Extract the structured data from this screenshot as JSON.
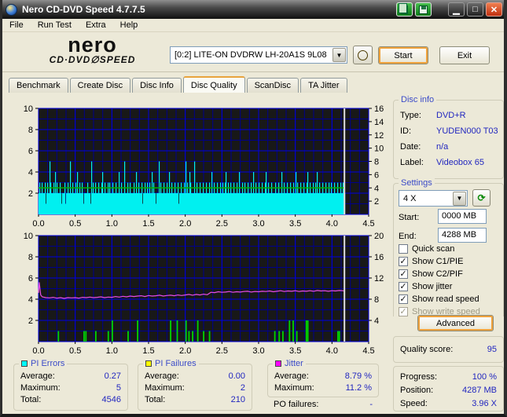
{
  "titlebar": {
    "title": "Nero CD-DVD Speed 4.7.7.5"
  },
  "menu": [
    "File",
    "Run Test",
    "Extra",
    "Help"
  ],
  "logo": {
    "line1": "nero",
    "line2": "CD·DVD∅SPEED"
  },
  "header": {
    "drive": "[0:2]   LITE-ON DVDRW LH-20A1S 9L08",
    "start_label": "Start",
    "exit_label": "Exit"
  },
  "tabs": [
    {
      "label": "Benchmark",
      "active": false
    },
    {
      "label": "Create Disc",
      "active": false
    },
    {
      "label": "Disc Info",
      "active": false
    },
    {
      "label": "Disc Quality",
      "active": true
    },
    {
      "label": "ScanDisc",
      "active": false
    },
    {
      "label": "TA Jitter",
      "active": false
    }
  ],
  "disc_info": {
    "title": "Disc info",
    "rows": [
      {
        "label": "Type:",
        "value": "DVD+R"
      },
      {
        "label": "ID:",
        "value": "YUDEN000 T03"
      },
      {
        "label": "Date:",
        "value": "n/a"
      },
      {
        "label": "Label:",
        "value": "Videobox 65"
      }
    ]
  },
  "settings": {
    "title": "Settings",
    "speed": "4 X",
    "start_label": "Start:",
    "start_value": "0000 MB",
    "end_label": "End:",
    "end_value": "4288 MB",
    "checkboxes": [
      {
        "label": "Quick scan",
        "checked": false,
        "enabled": true
      },
      {
        "label": "Show C1/PIE",
        "checked": true,
        "enabled": true
      },
      {
        "label": "Show C2/PIF",
        "checked": true,
        "enabled": true
      },
      {
        "label": "Show jitter",
        "checked": true,
        "enabled": true
      },
      {
        "label": "Show read speed",
        "checked": true,
        "enabled": true
      },
      {
        "label": "Show write speed",
        "checked": true,
        "enabled": false
      }
    ],
    "advanced_label": "Advanced"
  },
  "quality": {
    "label": "Quality score:",
    "value": "95"
  },
  "progress": {
    "rows": [
      {
        "label": "Progress:",
        "value": "100 %"
      },
      {
        "label": "Position:",
        "value": "4287 MB"
      },
      {
        "label": "Speed:",
        "value": "3.96 X"
      }
    ]
  },
  "stat_boxes": [
    {
      "title": "PI Errors",
      "color": "#00ffff",
      "rows": [
        {
          "label": "Average:",
          "value": "0.27"
        },
        {
          "label": "Maximum:",
          "value": "5"
        },
        {
          "label": "Total:",
          "value": "4546"
        }
      ]
    },
    {
      "title": "PI Failures",
      "color": "#ffff00",
      "rows": [
        {
          "label": "Average:",
          "value": "0.00"
        },
        {
          "label": "Maximum:",
          "value": "2"
        },
        {
          "label": "Total:",
          "value": "210"
        }
      ]
    },
    {
      "title": "Jitter",
      "color": "#ff00ff",
      "rows": [
        {
          "label": "Average:",
          "value": "8.79 %"
        },
        {
          "label": "Maximum:",
          "value": "11.2 %"
        }
      ]
    }
  ],
  "po_failures": {
    "label": "PO failures:",
    "value": "-"
  },
  "chart_data": [
    {
      "type": "bar",
      "name": "pi-errors-and-read-speed",
      "x_range": [
        0,
        4.5
      ],
      "x_major": 0.5,
      "x_minor": 0.125,
      "x_ticks": [
        "0.0",
        "0.5",
        "1.0",
        "1.5",
        "2.0",
        "2.5",
        "3.0",
        "3.5",
        "4.0",
        "4.5"
      ],
      "left_range": [
        0,
        10
      ],
      "left_major": 2,
      "left_minor": 1,
      "left_ticks": [
        2,
        4,
        6,
        8,
        10
      ],
      "right_range": [
        0,
        16
      ],
      "right_ticks": [
        2,
        4,
        6,
        8,
        10,
        12,
        14,
        16
      ],
      "bars_color": "#00f0f0",
      "bars_axis": "left",
      "bars_digits": "232232223123225322232423222321222312232252232223242232232122223222152322322232223422322232322232223222422322252223223222232242232223122322322322423221222523222322232242232223222312232223252322432222522322232223222322232242232223222322322342232232223222322422232232223222322422322232223222342232223222232223222422322232223222322423222322232223422322232232422322232223222322322232223222322322",
      "speed_line": {
        "value": 4.0,
        "axis": "right",
        "x_start": 0,
        "x_end": 4.17,
        "color": "#00b000"
      },
      "cursor_x": 4.17,
      "cursor_color": "#e0e0e0",
      "bg": "#181818",
      "grid_minor": "#00008c",
      "grid_major": "#0000e0"
    },
    {
      "type": "bar+line",
      "name": "pi-failures-and-jitter",
      "x_range": [
        0,
        4.5
      ],
      "x_major": 0.5,
      "x_minor": 0.125,
      "x_ticks": [
        "0.0",
        "0.5",
        "1.0",
        "1.5",
        "2.0",
        "2.5",
        "3.0",
        "3.5",
        "4.0",
        "4.5"
      ],
      "left_range": [
        0,
        10
      ],
      "left_major": 2,
      "left_minor": 1,
      "left_ticks": [
        2,
        4,
        6,
        8,
        10
      ],
      "right_range": [
        0,
        20
      ],
      "right_ticks": [
        4,
        8,
        12,
        16,
        20
      ],
      "pif_bars_color": "#00d400",
      "pif_bars": [
        [
          0.27,
          1
        ],
        [
          0.62,
          1
        ],
        [
          0.645,
          1
        ],
        [
          0.78,
          1
        ],
        [
          0.95,
          1
        ],
        [
          1.005,
          2
        ],
        [
          1.22,
          1
        ],
        [
          1.35,
          2
        ],
        [
          1.8,
          2
        ],
        [
          1.89,
          2
        ],
        [
          2.01,
          2
        ],
        [
          2.05,
          1
        ],
        [
          2.1,
          1
        ],
        [
          2.17,
          2
        ],
        [
          2.25,
          1
        ],
        [
          2.33,
          1
        ],
        [
          3.22,
          1
        ],
        [
          3.28,
          1
        ],
        [
          3.33,
          1
        ],
        [
          3.42,
          2
        ],
        [
          3.47,
          2
        ],
        [
          3.52,
          1
        ],
        [
          3.65,
          2
        ],
        [
          3.67,
          2
        ],
        [
          4.08,
          1
        ],
        [
          4.1,
          1
        ]
      ],
      "jitter_color": "#e84ce8",
      "jitter_axis": "right",
      "jitter_points": [
        [
          0.0,
          9.2
        ],
        [
          0.01,
          11.2
        ],
        [
          0.03,
          8.8
        ],
        [
          0.05,
          8.45
        ],
        [
          0.1,
          8.3
        ],
        [
          0.15,
          8.25
        ],
        [
          0.2,
          8.35
        ],
        [
          0.25,
          8.2
        ],
        [
          0.3,
          8.3
        ],
        [
          0.35,
          8.15
        ],
        [
          0.4,
          8.3
        ],
        [
          0.45,
          8.25
        ],
        [
          0.5,
          8.3
        ],
        [
          0.55,
          8.2
        ],
        [
          0.6,
          8.35
        ],
        [
          0.65,
          8.3
        ],
        [
          0.7,
          8.4
        ],
        [
          0.75,
          8.3
        ],
        [
          0.8,
          8.35
        ],
        [
          0.85,
          8.45
        ],
        [
          0.9,
          8.3
        ],
        [
          0.95,
          8.4
        ],
        [
          1.0,
          8.35
        ],
        [
          1.05,
          8.5
        ],
        [
          1.1,
          8.4
        ],
        [
          1.15,
          8.55
        ],
        [
          1.2,
          8.45
        ],
        [
          1.25,
          8.6
        ],
        [
          1.3,
          8.5
        ],
        [
          1.35,
          8.6
        ],
        [
          1.4,
          8.65
        ],
        [
          1.45,
          8.5
        ],
        [
          1.5,
          8.7
        ],
        [
          1.55,
          8.6
        ],
        [
          1.6,
          8.65
        ],
        [
          1.65,
          8.75
        ],
        [
          1.7,
          8.6
        ],
        [
          1.75,
          8.7
        ],
        [
          1.8,
          8.75
        ],
        [
          1.85,
          8.65
        ],
        [
          1.9,
          8.8
        ],
        [
          1.95,
          8.7
        ],
        [
          2.0,
          8.8
        ],
        [
          2.05,
          8.9
        ],
        [
          2.1,
          8.75
        ],
        [
          2.15,
          8.9
        ],
        [
          2.2,
          8.8
        ],
        [
          2.25,
          8.95
        ],
        [
          2.3,
          8.85
        ],
        [
          2.35,
          9.3
        ],
        [
          2.4,
          9.25
        ],
        [
          2.45,
          9.4
        ],
        [
          2.5,
          9.3
        ],
        [
          2.55,
          9.35
        ],
        [
          2.6,
          9.45
        ],
        [
          2.65,
          9.3
        ],
        [
          2.7,
          9.4
        ],
        [
          2.75,
          9.35
        ],
        [
          2.8,
          9.45
        ],
        [
          2.85,
          9.5
        ],
        [
          2.9,
          9.35
        ],
        [
          2.95,
          9.45
        ],
        [
          3.0,
          9.4
        ],
        [
          3.05,
          9.5
        ],
        [
          3.1,
          9.45
        ],
        [
          3.15,
          9.55
        ],
        [
          3.2,
          9.4
        ],
        [
          3.25,
          9.5
        ],
        [
          3.3,
          9.6
        ],
        [
          3.35,
          9.45
        ],
        [
          3.4,
          9.55
        ],
        [
          3.45,
          9.5
        ],
        [
          3.5,
          9.6
        ],
        [
          3.55,
          9.45
        ],
        [
          3.6,
          9.55
        ],
        [
          3.65,
          9.5
        ],
        [
          3.7,
          9.6
        ],
        [
          3.75,
          9.5
        ],
        [
          3.8,
          9.65
        ],
        [
          3.85,
          9.55
        ],
        [
          3.9,
          9.6
        ],
        [
          3.95,
          9.5
        ],
        [
          4.0,
          9.6
        ],
        [
          4.05,
          9.55
        ],
        [
          4.1,
          9.65
        ],
        [
          4.15,
          9.6
        ],
        [
          4.17,
          9.55
        ]
      ],
      "cursor_x": 4.17,
      "cursor_color": "#e0e0e0",
      "bg": "#181818",
      "grid_minor": "#00008c",
      "grid_major": "#0000e0"
    }
  ]
}
